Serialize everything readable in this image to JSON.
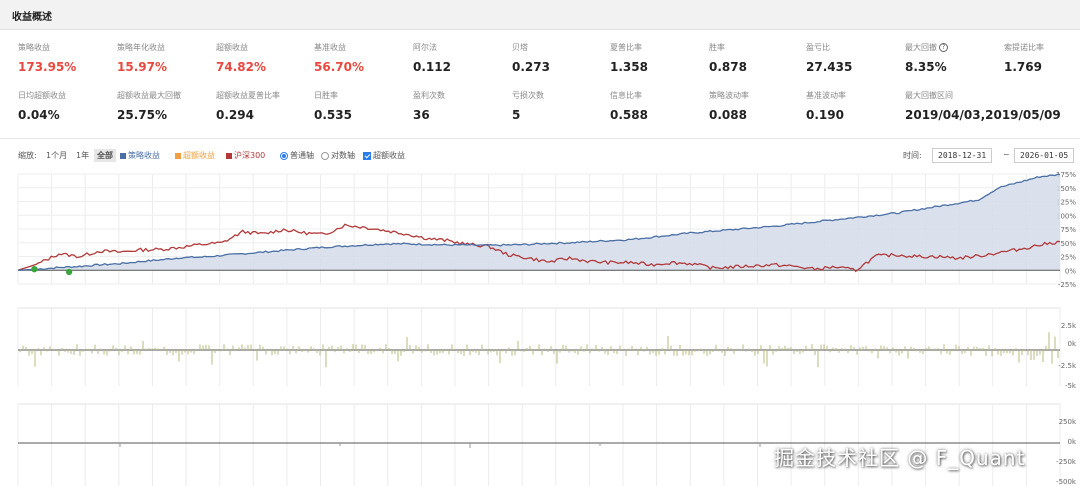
{
  "header": {
    "title": "收益概述"
  },
  "metrics_row1": [
    {
      "label": "策略收益",
      "value": "173.95%",
      "red": true
    },
    {
      "label": "策略年化收益",
      "value": "15.97%",
      "red": true
    },
    {
      "label": "超额收益",
      "value": "74.82%",
      "red": true
    },
    {
      "label": "基准收益",
      "value": "56.70%",
      "red": true
    },
    {
      "label": "阿尔法",
      "value": "0.112"
    },
    {
      "label": "贝塔",
      "value": "0.273"
    },
    {
      "label": "夏普比率",
      "value": "1.358"
    },
    {
      "label": "胜率",
      "value": "0.878"
    },
    {
      "label": "盈亏比",
      "value": "27.435"
    },
    {
      "label": "最大回撤",
      "value": "8.35%",
      "info": true
    },
    {
      "label": "索提诺比率",
      "value": "1.769"
    }
  ],
  "metrics_row2": [
    {
      "label": "日均超额收益",
      "value": "0.04%"
    },
    {
      "label": "超额收益最大回撤",
      "value": "25.75%"
    },
    {
      "label": "超额收益夏普比率",
      "value": "0.294"
    },
    {
      "label": "日胜率",
      "value": "0.535"
    },
    {
      "label": "盈利次数",
      "value": "36"
    },
    {
      "label": "亏损次数",
      "value": "5"
    },
    {
      "label": "信息比率",
      "value": "0.588"
    },
    {
      "label": "策略波动率",
      "value": "0.088"
    },
    {
      "label": "基准波动率",
      "value": "0.190"
    },
    {
      "label": "最大回撤区间",
      "value": "2019/04/03,2019/05/09"
    }
  ],
  "toolbar": {
    "zoom_label": "缩放:",
    "zoom_1m": "1个月",
    "zoom_1y": "1年",
    "zoom_all": "全部",
    "legend_strategy": "策略收益",
    "legend_excess": "超额收益",
    "legend_benchmark": "沪深300",
    "axis_normal": "普通轴",
    "axis_log": "对数轴",
    "excess_toggle": "超额收益",
    "time_label": "时间:",
    "start_date": "2018-12-31",
    "date_sep": "~",
    "end_date": "2026-01-05"
  },
  "colors": {
    "strategy": "#4a6fa5",
    "strategy_fill": "#d3dcea",
    "excess": "#f0a040",
    "benchmark": "#b03a3a",
    "marker": "#3aa63a",
    "bar": "#b8b880"
  },
  "chart_data": {
    "type": "line",
    "x_range": [
      "2018-12-31",
      "2026-01-05"
    ],
    "ylim": [
      -25,
      175
    ],
    "y_ticks": [
      "175%",
      "150%",
      "125%",
      "100%",
      "75%",
      "50%",
      "25%",
      "0%",
      "-25%"
    ],
    "series": [
      {
        "name": "策略收益",
        "values": [
          0,
          2,
          5,
          7,
          10,
          12,
          16,
          19,
          23,
          24,
          27,
          30,
          33,
          36,
          39,
          42,
          44,
          46,
          48,
          48,
          47,
          46,
          46,
          45,
          46,
          47,
          49,
          50,
          52,
          54,
          56,
          60,
          64,
          68,
          71,
          74,
          77,
          80,
          84,
          88,
          92,
          96,
          100,
          104,
          110,
          116,
          122,
          128,
          150,
          160,
          170,
          174
        ]
      },
      {
        "name": "沪深300",
        "values": [
          0,
          12,
          30,
          25,
          35,
          33,
          37,
          38,
          42,
          47,
          50,
          70,
          66,
          74,
          68,
          65,
          82,
          78,
          72,
          66,
          58,
          54,
          47,
          44,
          28,
          22,
          15,
          22,
          16,
          14,
          14,
          10,
          14,
          12,
          4,
          6,
          8,
          10,
          7,
          2,
          6,
          0,
          26,
          28,
          25,
          25,
          22,
          26,
          32,
          38,
          46,
          52
        ]
      }
    ],
    "markers": [
      {
        "index": 3,
        "value": 2
      },
      {
        "index": 4,
        "value": -3
      }
    ],
    "panel2_ticks": [
      "2.5k",
      "0k",
      "-2.5k",
      "-5k"
    ],
    "panel3_ticks": [
      "250k",
      "0k",
      "-250k",
      "-500k"
    ]
  },
  "watermark": "掘金技术社区 @ F_Quant"
}
